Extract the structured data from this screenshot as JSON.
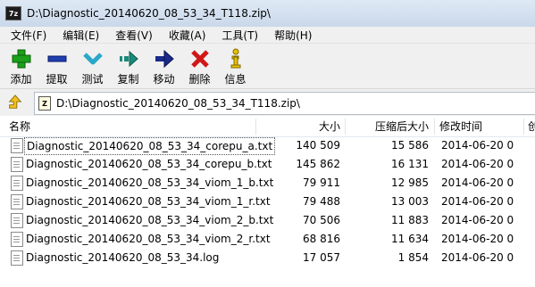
{
  "window": {
    "title": "D:\\Diagnostic_20140620_08_53_34_T118.zip\\",
    "app_icon_text": "7z"
  },
  "menu": [
    "文件(F)",
    "编辑(E)",
    "查看(V)",
    "收藏(A)",
    "工具(T)",
    "帮助(H)"
  ],
  "toolbar": [
    {
      "label": "添加",
      "icon": "add-icon",
      "color": "#1aa01a"
    },
    {
      "label": "提取",
      "icon": "extract-icon",
      "color": "#1f3fb0"
    },
    {
      "label": "测试",
      "icon": "test-icon",
      "color": "#2aa8c8"
    },
    {
      "label": "复制",
      "icon": "copy-icon",
      "color": "#1a8a7a"
    },
    {
      "label": "移动",
      "icon": "move-icon",
      "color": "#1a2a8a"
    },
    {
      "label": "删除",
      "icon": "delete-icon",
      "color": "#d01818"
    },
    {
      "label": "信息",
      "icon": "info-icon",
      "color": "#e8c000"
    }
  ],
  "address": {
    "path": "D:\\Diagnostic_20140620_08_53_34_T118.zip\\"
  },
  "columns": {
    "name": "名称",
    "size": "大小",
    "packed": "压缩后大小",
    "modified": "修改时间",
    "extra": "创"
  },
  "files": [
    {
      "name": "Diagnostic_20140620_08_53_34_corepu_a.txt",
      "size": "140 509",
      "packed": "15 586",
      "modified": "2014-06-20 0",
      "selected": true
    },
    {
      "name": "Diagnostic_20140620_08_53_34_corepu_b.txt",
      "size": "145 862",
      "packed": "16 131",
      "modified": "2014-06-20 0"
    },
    {
      "name": "Diagnostic_20140620_08_53_34_viom_1_b.txt",
      "size": "79 911",
      "packed": "12 985",
      "modified": "2014-06-20 0"
    },
    {
      "name": "Diagnostic_20140620_08_53_34_viom_1_r.txt",
      "size": "79 488",
      "packed": "13 003",
      "modified": "2014-06-20 0"
    },
    {
      "name": "Diagnostic_20140620_08_53_34_viom_2_b.txt",
      "size": "70 506",
      "packed": "11 883",
      "modified": "2014-06-20 0"
    },
    {
      "name": "Diagnostic_20140620_08_53_34_viom_2_r.txt",
      "size": "68 816",
      "packed": "11 634",
      "modified": "2014-06-20 0"
    },
    {
      "name": "Diagnostic_20140620_08_53_34.log",
      "size": "17 057",
      "packed": "1 854",
      "modified": "2014-06-20 0"
    }
  ]
}
